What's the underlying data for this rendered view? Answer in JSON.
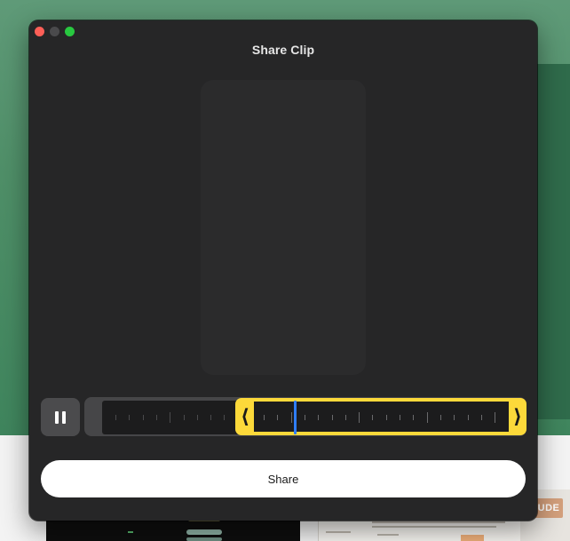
{
  "window": {
    "title": "Share Clip"
  },
  "controls": {
    "playback_state": "playing",
    "pause_icon": "pause-icon"
  },
  "share_button": {
    "label": "Share"
  },
  "background": {
    "badge_text": "UDE"
  },
  "colors": {
    "window_bg": "#262627",
    "selection": "#fcd93a",
    "playhead": "#2f7df6",
    "close": "#fe5f57",
    "maximize": "#28c840"
  }
}
